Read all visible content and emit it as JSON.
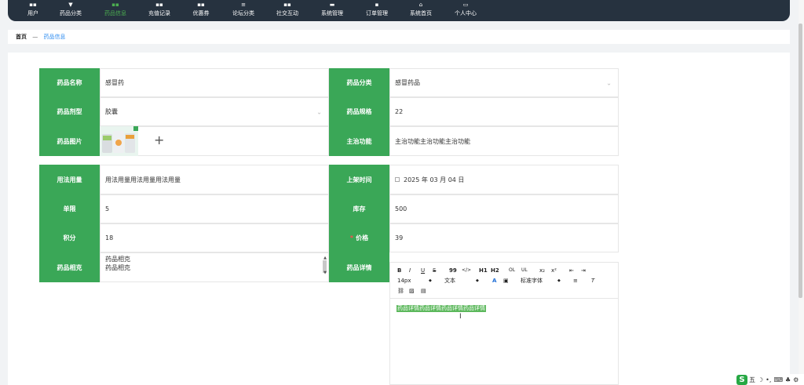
{
  "nav": {
    "items": [
      {
        "label": "用户",
        "icon": "grid-icon"
      },
      {
        "label": "药品分类",
        "icon": "pill-icon"
      },
      {
        "label": "药品信息",
        "icon": "grid-icon"
      },
      {
        "label": "充值记录",
        "icon": "grid-icon"
      },
      {
        "label": "优惠券",
        "icon": "grid-icon"
      },
      {
        "label": "论坛分类",
        "icon": "list-icon"
      },
      {
        "label": "社交互动",
        "icon": "grid-icon"
      },
      {
        "label": "系统管理",
        "icon": "chat-icon"
      },
      {
        "label": "订单管理",
        "icon": "box-icon"
      },
      {
        "label": "系统首页",
        "icon": "home-icon"
      },
      {
        "label": "个人中心",
        "icon": "calendar-icon"
      }
    ],
    "active_index": 2
  },
  "breadcrumb": {
    "home": "首页",
    "separator": "—",
    "current": "药品信息"
  },
  "form": {
    "drug_name_label": "药品名称",
    "drug_name_value": "感冒药",
    "category_label": "药品分类",
    "category_value": "感冒药品",
    "dosage_form_label": "药品剂型",
    "dosage_form_value": "胶囊",
    "spec_label": "药品规格",
    "spec_value": "22",
    "image_label": "药品图片",
    "indication_label": "主治功能",
    "indication_value": "主治功能主治功能主治功能",
    "usage_label": "用法用量",
    "usage_value": "用法用量用法用量用法用量",
    "shelf_time_label": "上架时间",
    "shelf_time_value": "2025 年 03 月 04 日",
    "limit_label": "单限",
    "limit_value": "5",
    "stock_label": "库存",
    "stock_value": "500",
    "points_label": "积分",
    "points_value": "18",
    "price_label": "价格",
    "price_required": "*",
    "price_value": "39",
    "contraindication_label": "药品相克",
    "contraindication_lines": [
      "药品相克",
      "药品相克"
    ],
    "details_label": "药品详情"
  },
  "editor": {
    "toolbar_row1": [
      "B",
      "I",
      "U",
      "S",
      "99",
      "</>",
      "H1",
      "H2",
      "OL",
      "UL",
      "x₂",
      "x²",
      "⇤",
      "⇥"
    ],
    "font_size": "14px",
    "text_style": "文本",
    "font_family": "标准字体",
    "content": "药品详情药品详情药品详情药品详情"
  },
  "ime": {
    "logo": "S",
    "mode": "五"
  },
  "colors": {
    "nav_bg": "#26323f",
    "accent_green": "#3aa757",
    "active_nav": "#4caf50",
    "link_blue": "#2d8cf0"
  }
}
